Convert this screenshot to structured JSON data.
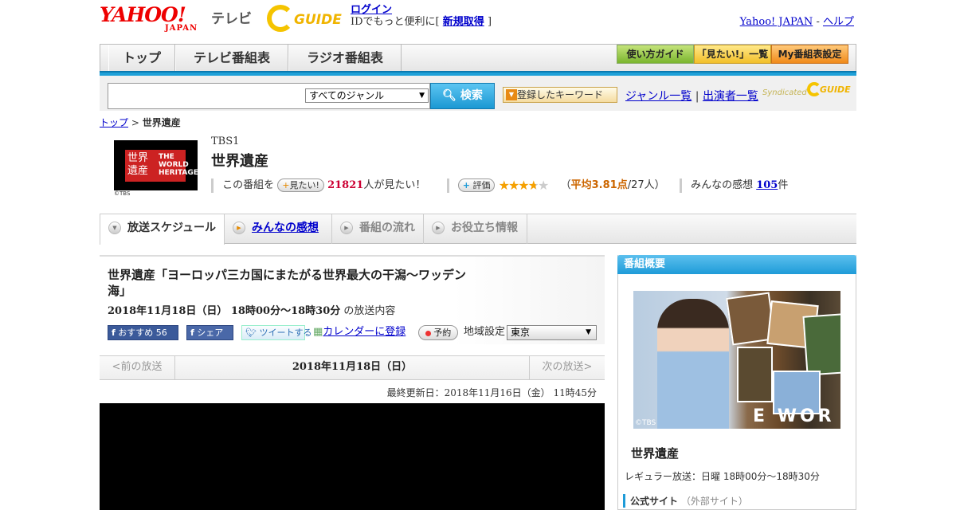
{
  "header": {
    "logo_text": "YAHOO!",
    "logo_sub": "JAPAN",
    "tv_label": "テレビ",
    "gguide_label": "GUIDE",
    "login_link": "ログイン",
    "login_text": "IDでもっと便利に[",
    "signup_link": "新規取得",
    "login_text_end": "]",
    "yahoo_link": "Yahoo! JAPAN",
    "separator": "-",
    "help_link": "ヘルプ"
  },
  "nav": {
    "tabs": [
      "トップ",
      "テレビ番組表",
      "ラジオ番組表"
    ],
    "buttons": [
      "使い方ガイド",
      "「見たい!」一覧",
      "My番組表設定"
    ]
  },
  "search": {
    "input_value": "",
    "genre_selected": "すべてのジャンル",
    "search_button": "検索",
    "keyword_button": "登録したキーワード",
    "genre_list_link": "ジャンル一覧",
    "divider": "|",
    "performer_list_link": "出演者一覧",
    "syndicated_label": "Syndicated",
    "syndicated_brand": "GUIDE"
  },
  "breadcrumb": {
    "top_link": "トップ",
    "sep": ">",
    "current": "世界遺産"
  },
  "program": {
    "logo_kanji": "世界遺産",
    "logo_english": "THE WORLD HERITAGE",
    "logo_credit": "©TBS",
    "channel": "TBS1",
    "title": "世界遺産",
    "want_prefix": "この番組を",
    "want_button": "見たい!",
    "want_count": "21821",
    "want_suffix": "人が見たい！",
    "rate_button": "評価",
    "rating_value": 3.81,
    "rating_stars_max": 5,
    "rating_paren_open": "（",
    "rating_avg_label": "平均3.81点",
    "rating_count": "/27人）",
    "impressions_label": "みんなの感想",
    "impressions_count": "105",
    "impressions_unit": "件"
  },
  "subtabs": {
    "schedule": "放送スケジュール",
    "impressions": "みんなの感想",
    "flow": "番組の流れ",
    "info": "お役立ち情報"
  },
  "episode": {
    "title": "世界遺産「ヨーロッパ三カ国にまたがる世界最大の干潟～ワッデン海」",
    "date": "2018年11月18日（日） 18時00分～18時30分",
    "date_suffix": "の放送内容",
    "recommend_label": "おすすめ",
    "recommend_count": "56",
    "share_label": "シェア",
    "tweet_label": "ツイートする",
    "calendar_label": "カレンダーに登録",
    "reserve_label": "予約",
    "area_label": "地域設定",
    "area_selected": "東京"
  },
  "pager": {
    "prev": "<前の放送",
    "current": "2018年11月18日（日）",
    "next": "次の放送>"
  },
  "last_updated": "最終更新日：2018年11月16日（金） 11時45分",
  "sidebar": {
    "heading": "番組概要",
    "image_credit": "©TBS",
    "image_word": "E WOR",
    "title": "世界遺産",
    "regular": "レギュラー放送：日曜 18時00分～18時30分",
    "official_label": "公式サイト",
    "official_ext": "（外部サイト）"
  },
  "colors": {
    "accent_blue": "#1e9bd8",
    "brand_red": "#ee0000",
    "gguide_yellow": "#f5c400",
    "want_pink": "#cc0033",
    "star_orange": "#f5a000"
  }
}
